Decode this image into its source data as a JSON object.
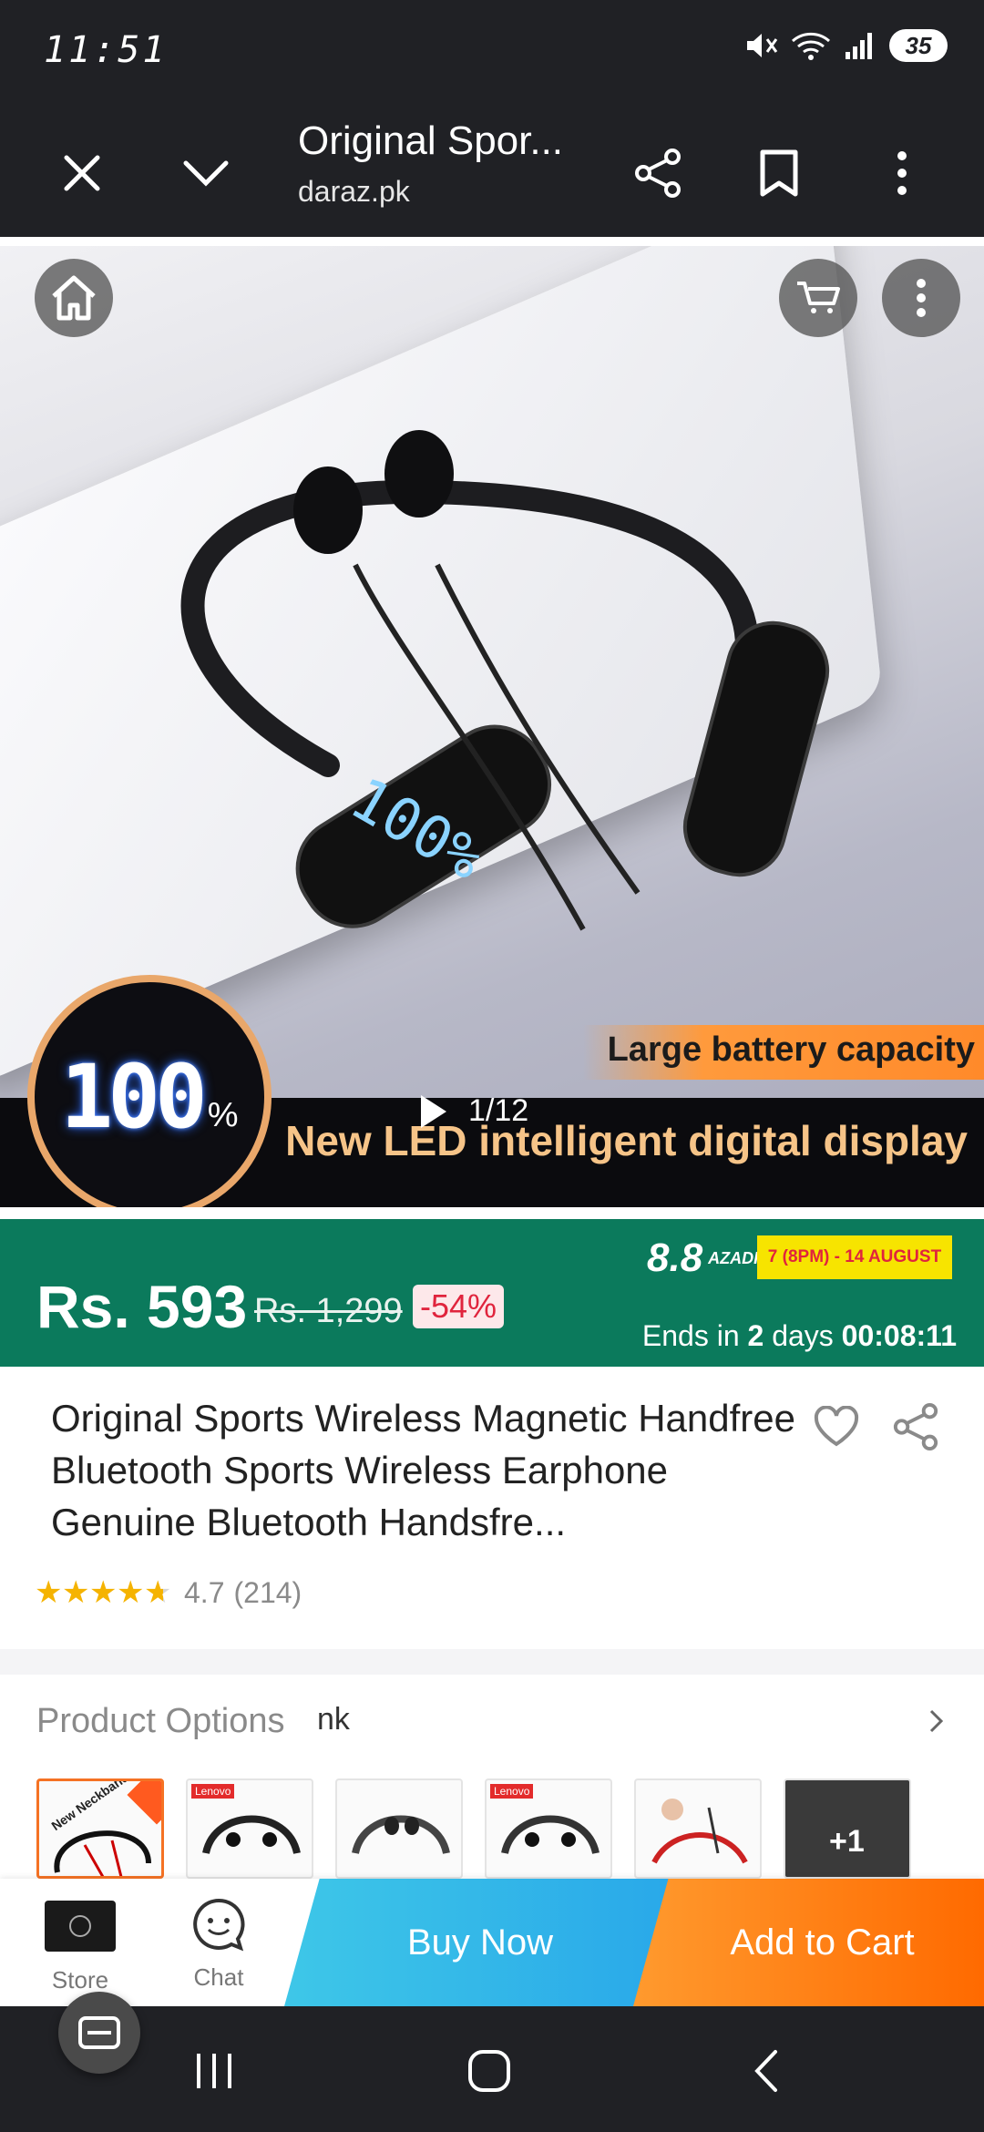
{
  "status_bar": {
    "time": "11:51",
    "battery": "35",
    "icons": [
      "mute-icon",
      "wifi-icon",
      "signal-icon",
      "battery-icon"
    ]
  },
  "browser": {
    "title": "Original Spor...",
    "url": "daraz.pk",
    "icons": [
      "close-icon",
      "chevron-down-icon",
      "share-icon",
      "bookmark-icon",
      "more-vert-icon"
    ]
  },
  "hero": {
    "badge_number": "100",
    "badge_unit": "%",
    "caption_top": "Large battery capacity",
    "caption_bottom": "New LED intelligent digital display",
    "counter": "1/12",
    "icons": [
      "home-icon",
      "cart-icon",
      "more-vert-icon",
      "play-icon"
    ]
  },
  "price": {
    "current": "Rs. 593",
    "original": "Rs. 1,299",
    "discount": "-54%",
    "sale_logo": "8.8",
    "sale_logo_small": "AZADI SALE",
    "sale_dates": "7 (8PM) - 14 AUGUST",
    "ends_prefix": "Ends in ",
    "ends_days": "2",
    "ends_mid": " days ",
    "ends_time": "00:08:11",
    "accent_color": "#0b7a5c"
  },
  "product": {
    "title": "Original Sports Wireless Magnetic Handfree Bluetooth Sports Wireless Earphone Genuine Bluetooth Handsfre...",
    "rating_value": "4.7",
    "rating_count": "(214)",
    "stars": 4.7
  },
  "options": {
    "label": "Product Options",
    "selected": "nk",
    "thumbs": [
      {
        "tag": "New Neckband"
      },
      {
        "tag": "Lenovo"
      },
      {
        "tag": ""
      },
      {
        "tag": "Lenovo"
      },
      {
        "tag": ""
      },
      {
        "tag": "+1"
      }
    ]
  },
  "actions": {
    "store_label": "Store",
    "chat_label": "Chat",
    "buy_now": "Buy Now",
    "add_to_cart": "Add to Cart"
  },
  "nav": {
    "icons": [
      "recents-icon",
      "home-nav-icon",
      "back-icon"
    ]
  }
}
